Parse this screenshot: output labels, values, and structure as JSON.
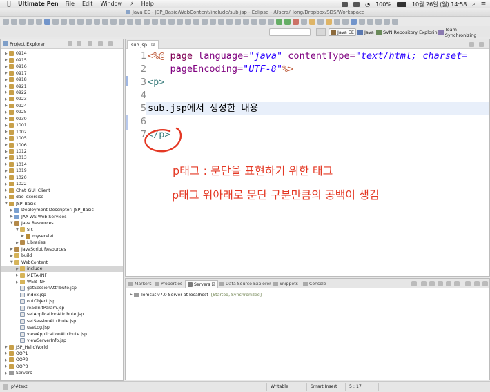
{
  "menubar": {
    "app_name": "Ultimate Pen",
    "items": [
      "File",
      "Edit",
      "Window",
      "Help"
    ],
    "battery": "100%",
    "datetime": "10월 26일 (월)  14:58"
  },
  "window": {
    "title": "Java EE - JSP_Basic/WebContent/include/sub.jsp - Eclipse - /Users/Hong/Dropbox/SDS/Workspace"
  },
  "perspectives": [
    {
      "label": "Java EE",
      "active": true
    },
    {
      "label": "Java",
      "active": false
    },
    {
      "label": "SVN Repository Exploring",
      "active": false
    },
    {
      "label": "Team Synchronizing",
      "active": false
    }
  ],
  "explorer": {
    "title": "Project Explorer",
    "items": [
      {
        "label": "0914",
        "depth": 0,
        "icon": "project",
        "expanded": false
      },
      {
        "label": "0915",
        "depth": 0,
        "icon": "project",
        "expanded": false
      },
      {
        "label": "0916",
        "depth": 0,
        "icon": "project",
        "expanded": false
      },
      {
        "label": "0917",
        "depth": 0,
        "icon": "project",
        "expanded": false
      },
      {
        "label": "0918",
        "depth": 0,
        "icon": "project",
        "expanded": false
      },
      {
        "label": "0921",
        "depth": 0,
        "icon": "project",
        "expanded": false
      },
      {
        "label": "0922",
        "depth": 0,
        "icon": "project",
        "expanded": false
      },
      {
        "label": "0923",
        "depth": 0,
        "icon": "project",
        "expanded": false
      },
      {
        "label": "0924",
        "depth": 0,
        "icon": "project",
        "expanded": false
      },
      {
        "label": "0925",
        "depth": 0,
        "icon": "project",
        "expanded": false
      },
      {
        "label": "0930",
        "depth": 0,
        "icon": "project",
        "expanded": false
      },
      {
        "label": "1001",
        "depth": 0,
        "icon": "project",
        "expanded": false
      },
      {
        "label": "1002",
        "depth": 0,
        "icon": "project",
        "expanded": false
      },
      {
        "label": "1005",
        "depth": 0,
        "icon": "project",
        "expanded": false
      },
      {
        "label": "1006",
        "depth": 0,
        "icon": "project",
        "expanded": false
      },
      {
        "label": "1012",
        "depth": 0,
        "icon": "project",
        "expanded": false
      },
      {
        "label": "1013",
        "depth": 0,
        "icon": "project",
        "expanded": false
      },
      {
        "label": "1014",
        "depth": 0,
        "icon": "project",
        "expanded": false
      },
      {
        "label": "1019",
        "depth": 0,
        "icon": "project",
        "expanded": false
      },
      {
        "label": "1020",
        "depth": 0,
        "icon": "project",
        "expanded": false
      },
      {
        "label": "1022",
        "depth": 0,
        "icon": "project",
        "expanded": false
      },
      {
        "label": "Chat_GUI_Client",
        "depth": 0,
        "icon": "project",
        "expanded": false
      },
      {
        "label": "dao_exercise",
        "depth": 0,
        "icon": "project",
        "expanded": false
      },
      {
        "label": "JSP_Basic",
        "depth": 0,
        "icon": "project",
        "expanded": true
      },
      {
        "label": "Deployment Descriptor: JSP_Basic",
        "depth": 1,
        "icon": "web",
        "expanded": false
      },
      {
        "label": "JAX-WS Web Services",
        "depth": 1,
        "icon": "web",
        "expanded": false
      },
      {
        "label": "Java Resources",
        "depth": 1,
        "icon": "lib",
        "expanded": true
      },
      {
        "label": "src",
        "depth": 2,
        "icon": "folder",
        "expanded": true
      },
      {
        "label": "myservlet",
        "depth": 3,
        "icon": "pkg",
        "expanded": false
      },
      {
        "label": "Libraries",
        "depth": 2,
        "icon": "lib",
        "expanded": false
      },
      {
        "label": "JavaScript Resources",
        "depth": 1,
        "icon": "lib",
        "expanded": false
      },
      {
        "label": "build",
        "depth": 1,
        "icon": "folder",
        "expanded": false
      },
      {
        "label": "WebContent",
        "depth": 1,
        "icon": "folder",
        "expanded": true
      },
      {
        "label": "include",
        "depth": 2,
        "icon": "folder",
        "expanded": false,
        "selected": true
      },
      {
        "label": "META-INF",
        "depth": 2,
        "icon": "folder",
        "expanded": false
      },
      {
        "label": "WEB-INF",
        "depth": 2,
        "icon": "folder",
        "expanded": false
      },
      {
        "label": "getSessionAttribute.jsp",
        "depth": 2,
        "icon": "file",
        "leaf": true
      },
      {
        "label": "index.jsp",
        "depth": 2,
        "icon": "file",
        "leaf": true
      },
      {
        "label": "outObject.jsp",
        "depth": 2,
        "icon": "file",
        "leaf": true
      },
      {
        "label": "readInitParam.jsp",
        "depth": 2,
        "icon": "file",
        "leaf": true
      },
      {
        "label": "setApplicationAttribute.jsp",
        "depth": 2,
        "icon": "file",
        "leaf": true
      },
      {
        "label": "setSessionAttribute.jsp",
        "depth": 2,
        "icon": "file",
        "leaf": true
      },
      {
        "label": "useLog.jsp",
        "depth": 2,
        "icon": "file",
        "leaf": true
      },
      {
        "label": "viewApplicationAttribute.jsp",
        "depth": 2,
        "icon": "file",
        "leaf": true
      },
      {
        "label": "viewServerInfo.jsp",
        "depth": 2,
        "icon": "file",
        "leaf": true
      },
      {
        "label": "JSP_HelloWorld",
        "depth": 0,
        "icon": "project",
        "expanded": false
      },
      {
        "label": "OOP1",
        "depth": 0,
        "icon": "project",
        "expanded": false
      },
      {
        "label": "OOP2",
        "depth": 0,
        "icon": "project",
        "expanded": false
      },
      {
        "label": "OOP3",
        "depth": 0,
        "icon": "project",
        "expanded": false
      },
      {
        "label": "Servers",
        "depth": 0,
        "icon": "srv",
        "expanded": false
      }
    ]
  },
  "editor": {
    "tab_label": "sub.jsp",
    "tab_close": "☒",
    "lines": [
      {
        "num": "1",
        "parts": [
          {
            "t": "<%@",
            "c": "dir"
          },
          {
            "t": " page ",
            "c": "kw"
          },
          {
            "t": "language=",
            "c": "attr"
          },
          {
            "t": "\"java\"",
            "c": "val"
          },
          {
            "t": " contentType=",
            "c": "attr"
          },
          {
            "t": "\"text/html; charset=",
            "c": "val"
          }
        ]
      },
      {
        "num": "2",
        "parts": [
          {
            "t": "    pageEncoding=",
            "c": "attr"
          },
          {
            "t": "\"UTF-8\"",
            "c": "val"
          },
          {
            "t": "%>",
            "c": "dir"
          }
        ]
      },
      {
        "num": "3",
        "parts": [
          {
            "t": "<p>",
            "c": "tag"
          }
        ]
      },
      {
        "num": "4",
        "parts": []
      },
      {
        "num": "5",
        "parts": [
          {
            "t": "sub.jsp에서 생성한 내용",
            "c": "plain"
          }
        ]
      },
      {
        "num": "6",
        "parts": []
      },
      {
        "num": "7",
        "parts": [
          {
            "t": "</p>",
            "c": "tag"
          }
        ]
      }
    ]
  },
  "annotation": {
    "line1": "p태그 : 문단을 표현하기 위한 태그",
    "line2": "p태그 위아래로 문단 구분만큼의 공백이 생김",
    "color": "#e43824"
  },
  "bottom_panel": {
    "tabs": [
      {
        "label": "Markers",
        "active": false
      },
      {
        "label": "Properties",
        "active": false
      },
      {
        "label": "Servers ☒",
        "active": true
      },
      {
        "label": "Data Source Explorer",
        "active": false
      },
      {
        "label": "Snippets",
        "active": false
      },
      {
        "label": "Console",
        "active": false
      }
    ],
    "server_row": {
      "label": "Tomcat v7.0 Server at localhost",
      "status": "[Started, Synchronized]"
    }
  },
  "statusbar": {
    "path": "p/#text",
    "mode": "Writable",
    "insert": "Smart Insert",
    "position": "5 : 17"
  }
}
